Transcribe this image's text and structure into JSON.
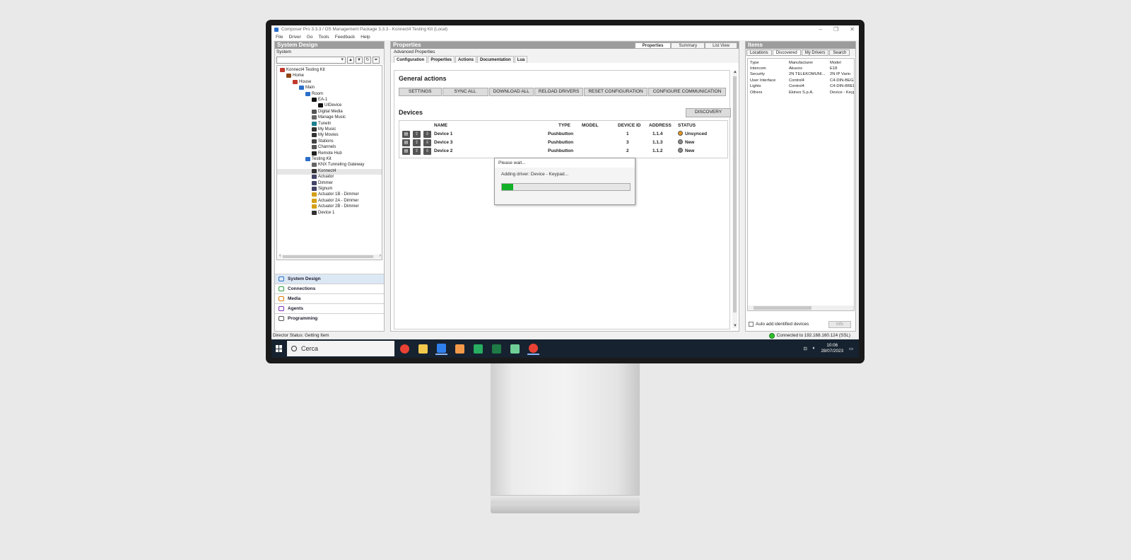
{
  "window": {
    "title": "Composer Pro 3.3.3 / OS Management Package 3.3.3 - Konnect4 Testing Kit (Local)",
    "controls": [
      "–",
      "❐",
      "✕"
    ]
  },
  "menu": [
    "File",
    "Driver",
    "Go",
    "Tools",
    "Feedback",
    "Help"
  ],
  "system_design": {
    "header": "System Design",
    "sub": "System",
    "tree": [
      {
        "label": "Konnect4 Testing Kit",
        "level": 0,
        "icon": "project-icon",
        "color": "#c0392b"
      },
      {
        "label": "Home",
        "level": 1,
        "icon": "home-icon",
        "color": "#8b4513"
      },
      {
        "label": "House",
        "level": 2,
        "icon": "house-icon",
        "color": "#c0392b"
      },
      {
        "label": "Main",
        "level": 3,
        "icon": "floor-icon",
        "color": "#2a6fc9"
      },
      {
        "label": "Room",
        "level": 4,
        "icon": "room-icon",
        "color": "#2a6fc9"
      },
      {
        "label": "EA-1",
        "level": 5,
        "icon": "device-icon",
        "color": "#111"
      },
      {
        "label": "UIDevice",
        "level": 6,
        "icon": "uidevice-icon",
        "color": "#111"
      },
      {
        "label": "Digital Media",
        "level": 5,
        "icon": "media-icon",
        "color": "#555"
      },
      {
        "label": "Manage Music",
        "level": 5,
        "icon": "music-icon",
        "color": "#666"
      },
      {
        "label": "TuneIn",
        "level": 5,
        "icon": "tunein-icon",
        "color": "#1a7f8f"
      },
      {
        "label": "My Music",
        "level": 5,
        "icon": "music-icon",
        "color": "#333"
      },
      {
        "label": "My Movies",
        "level": 5,
        "icon": "movies-icon",
        "color": "#333"
      },
      {
        "label": "Stations",
        "level": 5,
        "icon": "stations-icon",
        "color": "#444"
      },
      {
        "label": "Channels",
        "level": 5,
        "icon": "channels-icon",
        "color": "#555"
      },
      {
        "label": "Remote Hub",
        "level": 5,
        "icon": "remote-hub-icon",
        "color": "#222"
      },
      {
        "label": "Testing Kit",
        "level": 4,
        "icon": "room-icon",
        "color": "#2a6fc9"
      },
      {
        "label": "KNX Tunneling Gateway",
        "level": 5,
        "icon": "gateway-icon",
        "color": "#666"
      },
      {
        "label": "Konnect4",
        "level": 5,
        "icon": "konnect-icon",
        "color": "#333"
      },
      {
        "label": "Actuator",
        "level": 5,
        "icon": "actuator-icon",
        "color": "#446"
      },
      {
        "label": "Dimmer",
        "level": 5,
        "icon": "dimmer-icon",
        "color": "#446"
      },
      {
        "label": "Signum",
        "level": 5,
        "icon": "signum-icon",
        "color": "#446"
      },
      {
        "label": "Actuator 1B - Dimmer",
        "level": 5,
        "icon": "light-icon",
        "color": "#d4a017"
      },
      {
        "label": "Actuator 2A - Dimmer",
        "level": 5,
        "icon": "light-icon",
        "color": "#d4a017"
      },
      {
        "label": "Actuator 2B - Dimmer",
        "level": 5,
        "icon": "light-icon",
        "color": "#d4a017"
      },
      {
        "label": "Device 1",
        "level": 5,
        "icon": "keypad-icon",
        "color": "#333"
      }
    ],
    "nav": [
      {
        "label": "System Design",
        "color": "#2a6fc9"
      },
      {
        "label": "Connections",
        "color": "#2a9d3a"
      },
      {
        "label": "Media",
        "color": "#e07b00"
      },
      {
        "label": "Agents",
        "color": "#7b2fbf"
      },
      {
        "label": "Programming",
        "color": "#555"
      }
    ]
  },
  "properties": {
    "header": "Properties",
    "view_tabs": [
      "Properties",
      "Summary",
      "List View"
    ],
    "advanced": "Advanced Properties",
    "sub_tabs": [
      "Configuration",
      "Properties",
      "Actions",
      "Documentation",
      "Lua"
    ],
    "general_title": "General actions",
    "actions": [
      "SETTINGS",
      "SYNC ALL",
      "DOWNLOAD ALL",
      "RELOAD DRIVERS",
      "RESET CONFIGURATION",
      "CONFIGURE COMMUNICATION"
    ],
    "devices_title": "Devices",
    "discovery": "DISCOVERY",
    "columns": {
      "name": "NAME",
      "type": "TYPE",
      "model": "MODEL",
      "device_id": "DEVICE ID",
      "address": "ADDRESS",
      "status": "STATUS"
    },
    "devices": [
      {
        "name": "Device 1",
        "type": "Pushbutton",
        "model": "",
        "device_id": "1",
        "address": "1.1.4",
        "status": "Unsynced",
        "status_color": "#e8961e"
      },
      {
        "name": "Device 3",
        "type": "Pushbutton",
        "model": "",
        "device_id": "3",
        "address": "1.1.3",
        "status": "New",
        "status_color": "#8a8a8a"
      },
      {
        "name": "Device 2",
        "type": "Pushbutton",
        "model": "",
        "device_id": "2",
        "address": "1.1.2",
        "status": "New",
        "status_color": "#8a8a8a"
      }
    ]
  },
  "dialog": {
    "title": "Please wait...",
    "message": "Adding driver: Device - Keypad...",
    "progress": 0.09
  },
  "items": {
    "header": "Items",
    "tabs": [
      "Locations",
      "Discovered",
      "My Drivers",
      "Search"
    ],
    "columns": [
      "Type",
      "Manufacturer",
      "Model"
    ],
    "rows": [
      [
        "Intercom",
        "Akuvox",
        "E18"
      ],
      [
        "Security",
        "2N TELEKOMUNI...",
        "2N IP Vario"
      ],
      [
        "User Interface",
        "Control4",
        "C4-DIN-BEG-..."
      ],
      [
        "Lights",
        "Control4",
        "C4-DIN-8REL..."
      ],
      [
        "Others",
        "Ekinex S.p.A.",
        "Device - Keyp..."
      ]
    ],
    "auto_add": "Auto add identified devices",
    "info": "Info"
  },
  "status": {
    "left": "Director Status: Getting Item",
    "connection": "Connected to 192.168.160.124 (SSL)"
  },
  "taskbar": {
    "search": "Cerca",
    "apps": [
      {
        "name": "chrome",
        "color": "#e94235"
      },
      {
        "name": "file-explorer",
        "color": "#f2c94c"
      },
      {
        "name": "composer",
        "color": "#2f80ed"
      },
      {
        "name": "sketch",
        "color": "#f2994a"
      },
      {
        "name": "app-green-1",
        "color": "#27ae60"
      },
      {
        "name": "excel",
        "color": "#1e7b45"
      },
      {
        "name": "notes",
        "color": "#6fcf97"
      },
      {
        "name": "chrome-2",
        "color": "#e94235"
      }
    ],
    "time": "10:06",
    "date": "28/07/2023"
  }
}
